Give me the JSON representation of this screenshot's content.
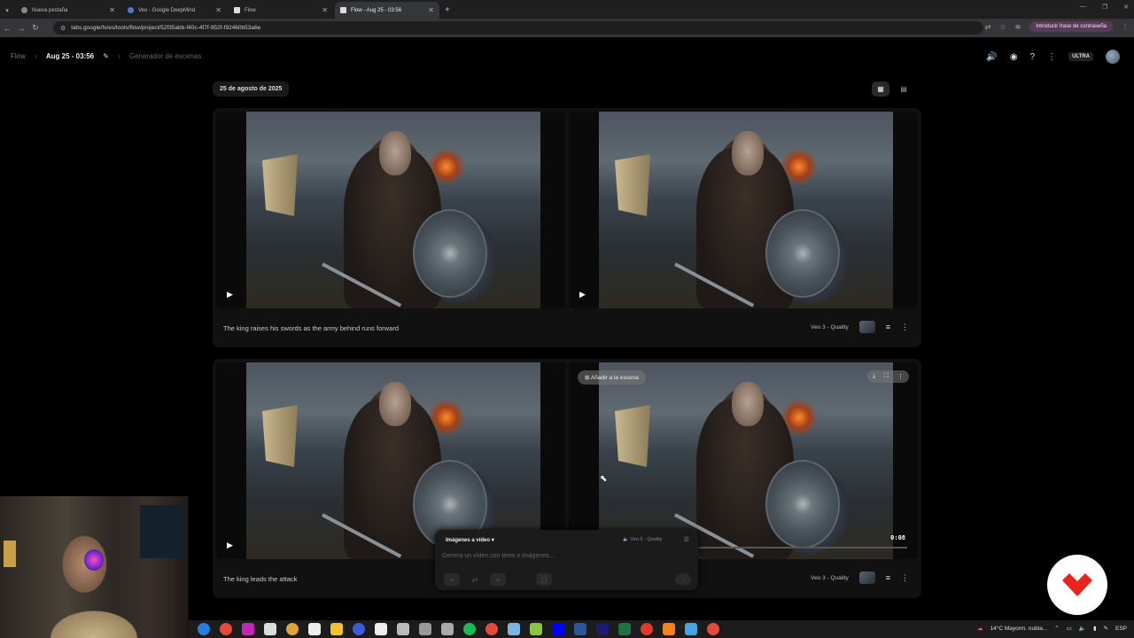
{
  "browser": {
    "tabs": [
      {
        "label": "Nueva pestaña",
        "active": false
      },
      {
        "label": "Veo - Google DeepMind",
        "active": false
      },
      {
        "label": "Flow",
        "active": false
      },
      {
        "label": "Flow - Aug 25 - 03:56",
        "active": true
      }
    ],
    "url": "labs.google/fx/es/tools/flow/project/52f35abb-f40c-4f7f-952f-f92460b53a6e",
    "password_button": "Introducir frase de contraseña"
  },
  "breadcrumb": {
    "root": "Flow",
    "project": "Aug 25 - 03:56",
    "section": "Generador de escenas"
  },
  "header": {
    "plan_badge": "ULTRA"
  },
  "date_label": "25 de agosto de 2025",
  "cards": [
    {
      "caption": "The king raises his swords as the army behind runs forward",
      "model": "Veo 3 - Quality"
    },
    {
      "caption": "The king leads the attack",
      "model": "Veo 3 - Quality",
      "add_to_scene": "Añadir a la escena",
      "timecode": "0:08"
    }
  ],
  "prompt": {
    "mode": "Imágenes a vídeo",
    "model": "Veo 3 - Quality",
    "placeholder": "Genera un vídeo con texto e imágenes..."
  },
  "taskbar": {
    "weather": "14°C  Mayorm. nubla...",
    "lang": "ESP"
  },
  "colors": {
    "logo_red": "#e8241c",
    "password_button_bg": "#5a3a56"
  }
}
